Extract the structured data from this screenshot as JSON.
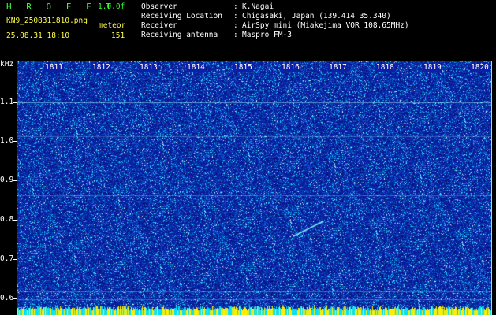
{
  "header": {
    "title": "H R O F F T",
    "version": "1.0.0f",
    "filename": "KN9_2508311810.png",
    "mode": "meteor",
    "datetime": "25.08.31 18:10",
    "count": "151"
  },
  "info": {
    "rows": [
      {
        "label": "Observer",
        "value": "K.Nagai"
      },
      {
        "label": "Receiving Location",
        "value": "Chigasaki, Japan (139.414 35.340)"
      },
      {
        "label": "Receiver",
        "value": "AirSpy mini (Miakejima VOR 108.65MHz)"
      },
      {
        "label": "Receiving antenna",
        "value": "Maspro FM-3"
      }
    ],
    "colon": ":"
  },
  "spectrogram": {
    "y_unit": "kHz",
    "y_ticks": [
      "1.1",
      "1.0",
      "0.9",
      "0.8",
      "0.7",
      "0.6"
    ],
    "x_ticks": [
      "1811",
      "1812",
      "1813",
      "1814",
      "1815",
      "1816",
      "1817",
      "1818",
      "1819",
      "1820"
    ],
    "colors": {
      "background": "#0a1d9e",
      "noise_cyan": "#2fd3ff",
      "noise_white": "#dff6ff",
      "baseline": "#ffee00"
    }
  }
}
